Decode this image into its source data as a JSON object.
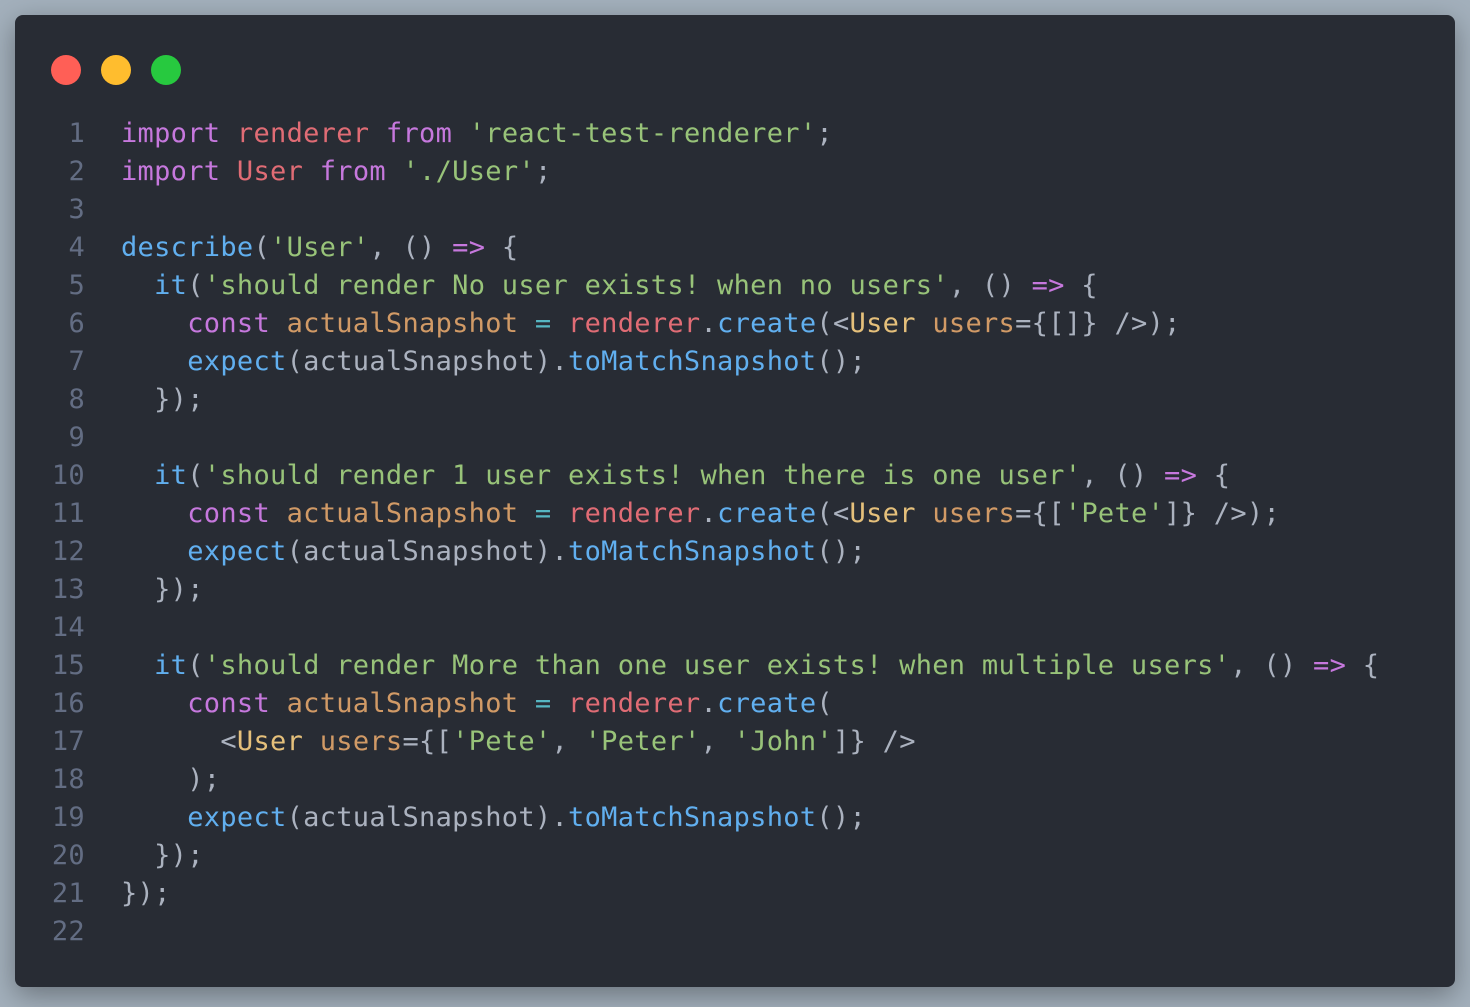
{
  "window": {
    "controls": [
      {
        "name": "close-button",
        "color": "#ff5f56"
      },
      {
        "name": "minimize-button",
        "color": "#ffbd2e"
      },
      {
        "name": "maximize-button",
        "color": "#27c93f"
      }
    ]
  },
  "code": {
    "lines": [
      {
        "num": "1",
        "tokens": [
          [
            "keyword",
            "import"
          ],
          [
            "plain",
            " "
          ],
          [
            "var",
            "renderer"
          ],
          [
            "plain",
            " "
          ],
          [
            "keyword",
            "from"
          ],
          [
            "plain",
            " "
          ],
          [
            "string",
            "'react-test-renderer'"
          ],
          [
            "punct",
            ";"
          ]
        ]
      },
      {
        "num": "2",
        "tokens": [
          [
            "keyword",
            "import"
          ],
          [
            "plain",
            " "
          ],
          [
            "var",
            "User"
          ],
          [
            "plain",
            " "
          ],
          [
            "keyword",
            "from"
          ],
          [
            "plain",
            " "
          ],
          [
            "string",
            "'./User'"
          ],
          [
            "punct",
            ";"
          ]
        ]
      },
      {
        "num": "3",
        "tokens": []
      },
      {
        "num": "4",
        "tokens": [
          [
            "function",
            "describe"
          ],
          [
            "punct",
            "("
          ],
          [
            "string",
            "'User'"
          ],
          [
            "punct",
            ", () "
          ],
          [
            "keyword",
            "=>"
          ],
          [
            "punct",
            " {"
          ]
        ]
      },
      {
        "num": "5",
        "tokens": [
          [
            "plain",
            "  "
          ],
          [
            "function",
            "it"
          ],
          [
            "punct",
            "("
          ],
          [
            "string",
            "'should render No user exists! when no users'"
          ],
          [
            "punct",
            ", () "
          ],
          [
            "keyword",
            "=>"
          ],
          [
            "punct",
            " {"
          ]
        ]
      },
      {
        "num": "6",
        "tokens": [
          [
            "plain",
            "    "
          ],
          [
            "keyword",
            "const"
          ],
          [
            "plain",
            " "
          ],
          [
            "const",
            "actualSnapshot"
          ],
          [
            "plain",
            " "
          ],
          [
            "operator",
            "="
          ],
          [
            "plain",
            " "
          ],
          [
            "var",
            "renderer"
          ],
          [
            "punct",
            "."
          ],
          [
            "function",
            "create"
          ],
          [
            "punct",
            "(<"
          ],
          [
            "component",
            "User"
          ],
          [
            "plain",
            " "
          ],
          [
            "attr",
            "users"
          ],
          [
            "punct",
            "={[]} />);"
          ]
        ]
      },
      {
        "num": "7",
        "tokens": [
          [
            "plain",
            "    "
          ],
          [
            "function",
            "expect"
          ],
          [
            "punct",
            "(actualSnapshot)."
          ],
          [
            "function",
            "toMatchSnapshot"
          ],
          [
            "punct",
            "();"
          ]
        ]
      },
      {
        "num": "8",
        "tokens": [
          [
            "plain",
            "  "
          ],
          [
            "punct",
            "});"
          ]
        ]
      },
      {
        "num": "9",
        "tokens": []
      },
      {
        "num": "10",
        "tokens": [
          [
            "plain",
            "  "
          ],
          [
            "function",
            "it"
          ],
          [
            "punct",
            "("
          ],
          [
            "string",
            "'should render 1 user exists! when there is one user'"
          ],
          [
            "punct",
            ", () "
          ],
          [
            "keyword",
            "=>"
          ],
          [
            "punct",
            " {"
          ]
        ]
      },
      {
        "num": "11",
        "tokens": [
          [
            "plain",
            "    "
          ],
          [
            "keyword",
            "const"
          ],
          [
            "plain",
            " "
          ],
          [
            "const",
            "actualSnapshot"
          ],
          [
            "plain",
            " "
          ],
          [
            "operator",
            "="
          ],
          [
            "plain",
            " "
          ],
          [
            "var",
            "renderer"
          ],
          [
            "punct",
            "."
          ],
          [
            "function",
            "create"
          ],
          [
            "punct",
            "(<"
          ],
          [
            "component",
            "User"
          ],
          [
            "plain",
            " "
          ],
          [
            "attr",
            "users"
          ],
          [
            "punct",
            "={["
          ],
          [
            "string",
            "'Pete'"
          ],
          [
            "punct",
            "]} />);"
          ]
        ]
      },
      {
        "num": "12",
        "tokens": [
          [
            "plain",
            "    "
          ],
          [
            "function",
            "expect"
          ],
          [
            "punct",
            "(actualSnapshot)."
          ],
          [
            "function",
            "toMatchSnapshot"
          ],
          [
            "punct",
            "();"
          ]
        ]
      },
      {
        "num": "13",
        "tokens": [
          [
            "plain",
            "  "
          ],
          [
            "punct",
            "});"
          ]
        ]
      },
      {
        "num": "14",
        "tokens": []
      },
      {
        "num": "15",
        "tokens": [
          [
            "plain",
            "  "
          ],
          [
            "function",
            "it"
          ],
          [
            "punct",
            "("
          ],
          [
            "string",
            "'should render More than one user exists! when multiple users'"
          ],
          [
            "punct",
            ", () "
          ],
          [
            "keyword",
            "=>"
          ],
          [
            "punct",
            " {"
          ]
        ]
      },
      {
        "num": "16",
        "tokens": [
          [
            "plain",
            "    "
          ],
          [
            "keyword",
            "const"
          ],
          [
            "plain",
            " "
          ],
          [
            "const",
            "actualSnapshot"
          ],
          [
            "plain",
            " "
          ],
          [
            "operator",
            "="
          ],
          [
            "plain",
            " "
          ],
          [
            "var",
            "renderer"
          ],
          [
            "punct",
            "."
          ],
          [
            "function",
            "create"
          ],
          [
            "punct",
            "("
          ]
        ]
      },
      {
        "num": "17",
        "tokens": [
          [
            "plain",
            "      "
          ],
          [
            "punct",
            "<"
          ],
          [
            "component",
            "User"
          ],
          [
            "plain",
            " "
          ],
          [
            "attr",
            "users"
          ],
          [
            "punct",
            "={["
          ],
          [
            "string",
            "'Pete'"
          ],
          [
            "punct",
            ", "
          ],
          [
            "string",
            "'Peter'"
          ],
          [
            "punct",
            ", "
          ],
          [
            "string",
            "'John'"
          ],
          [
            "punct",
            "]} />"
          ]
        ]
      },
      {
        "num": "18",
        "tokens": [
          [
            "plain",
            "    "
          ],
          [
            "punct",
            ");"
          ]
        ]
      },
      {
        "num": "19",
        "tokens": [
          [
            "plain",
            "    "
          ],
          [
            "function",
            "expect"
          ],
          [
            "punct",
            "(actualSnapshot)."
          ],
          [
            "function",
            "toMatchSnapshot"
          ],
          [
            "punct",
            "();"
          ]
        ]
      },
      {
        "num": "20",
        "tokens": [
          [
            "plain",
            "  "
          ],
          [
            "punct",
            "});"
          ]
        ]
      },
      {
        "num": "21",
        "tokens": [
          [
            "punct",
            "});"
          ]
        ]
      },
      {
        "num": "22",
        "tokens": []
      }
    ]
  }
}
